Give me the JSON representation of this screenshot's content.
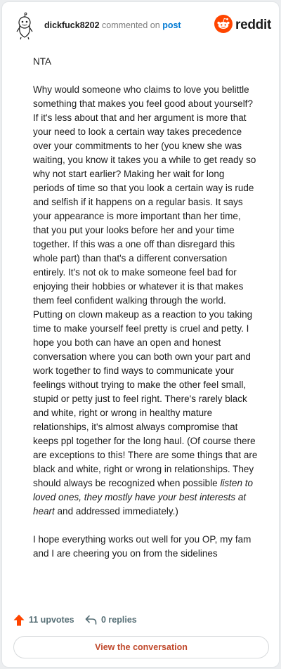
{
  "header": {
    "username": "dickfuck8202",
    "action_text": "commented on",
    "link_text": "post",
    "brand_wordmark": "reddit",
    "brand_color": "#ff4500",
    "link_color": "#0079d3"
  },
  "comment": {
    "verdict": "NTA",
    "paragraph_main_1": "Why would someone who claims to love you belittle something that makes you feel good about yourself? If it's less about that and her argument is more that your need to look a certain way takes precedence over your commitments to her (you knew she was waiting, you know it takes you a while to get ready so why not start earlier? Making her wait for long periods of time so that you look a certain way is rude and selfish if it happens on a regular basis. It says your appearance is more important than her time, that you put your looks before her and your time together. If this was a one off than disregard this whole part) than that's a different conversation entirely. It's not ok to make someone feel bad for enjoying their hobbies or whatever it is that makes them feel confident walking through the world. Putting on clown makeup as a reaction to you taking time to make yourself feel pretty is cruel and petty. I hope you both can have an open and honest conversation where you can both own your part and work together to find ways to communicate your feelings without trying to make the other feel small, stupid or petty just to feel right. There's rarely black and white, right or wrong in healthy mature relationships, it's almost always compromise that keeps ppl together for the long haul. (Of course there are exceptions to this! There are some things that are black and white, right or wrong in relationships. They should always be recognized when possible",
    "paragraph_main_italic": "listen to loved ones, they mostly have your best interests at heart",
    "paragraph_main_2": "and addressed immediately.)",
    "paragraph_closing": "I hope everything works out well for you OP, my fam and I are cheering you on from the sidelines"
  },
  "actions": {
    "upvotes_label": "11 upvotes",
    "replies_label": "0 replies",
    "upvote_color": "#ff4500",
    "view_button_label": "View the conversation"
  },
  "icons": {
    "avatar": "snoo-avatar-icon",
    "brand": "reddit-logo-icon",
    "upvote": "upvote-arrow-icon",
    "reply": "reply-arrow-icon"
  }
}
